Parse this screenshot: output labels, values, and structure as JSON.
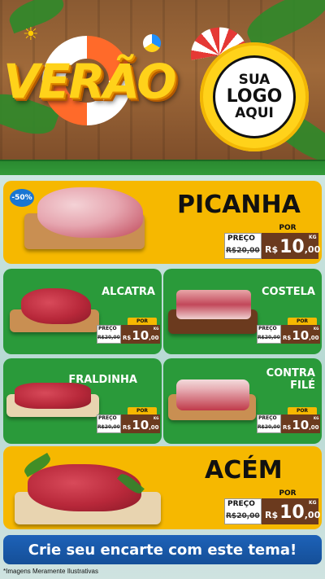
{
  "header": {
    "title": "VERÃO",
    "logo_line1": "SUA",
    "logo_line2": "LOGO",
    "logo_line3": "AQUI"
  },
  "colors": {
    "yellow": "#f6b800",
    "green": "#2a9a3a",
    "blue": "#1d62b8",
    "price_brown": "#6b3a1e"
  },
  "products": [
    {
      "name": "PICANHA",
      "badge": "-50%",
      "por": "POR",
      "preco": "PREÇO",
      "old": "R$20,00",
      "currency": "R$",
      "price_int": "10",
      "price_dec": ",00",
      "unit": "KG"
    },
    {
      "name": "ALCATRA",
      "por": "POR",
      "preco": "PREÇO",
      "old": "R$20,00",
      "currency": "R$",
      "price_int": "10",
      "price_dec": ",00",
      "unit": "KG"
    },
    {
      "name": "COSTELA",
      "por": "POR",
      "preco": "PREÇO",
      "old": "R$20,00",
      "currency": "R$",
      "price_int": "10",
      "price_dec": ",00",
      "unit": "KG"
    },
    {
      "name": "FRALDINHA",
      "por": "POR",
      "preco": "PREÇO",
      "old": "R$20,00",
      "currency": "R$",
      "price_int": "10",
      "price_dec": ",00",
      "unit": "KG"
    },
    {
      "name_line1": "CONTRA",
      "name_line2": "FILÉ",
      "por": "POR",
      "preco": "PREÇO",
      "old": "R$20,00",
      "currency": "R$",
      "price_int": "10",
      "price_dec": ",00",
      "unit": "KG"
    },
    {
      "name": "ACÉM",
      "por": "POR",
      "preco": "PREÇO",
      "old": "R$20,00",
      "currency": "R$",
      "price_int": "10",
      "price_dec": ",00",
      "unit": "KG"
    }
  ],
  "cta_label": "Crie seu encarte com este tema!",
  "footnote": "*Imagens Meramente Ilustrativas"
}
